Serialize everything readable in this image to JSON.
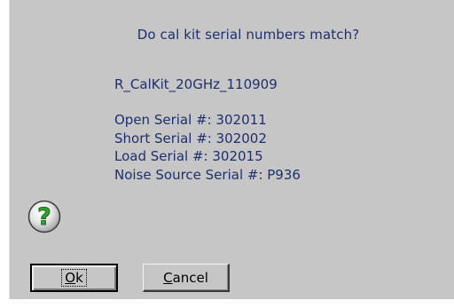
{
  "dialog": {
    "question": "Do cal kit serial numbers match?",
    "calkit_name": "R_CalKit_20GHz_110909",
    "serials": {
      "open": "Open Serial #: 302011",
      "short": "Short Serial #: 302002",
      "load": "Load Serial #: 302015",
      "noise": "Noise Source Serial #: P936"
    },
    "icon": "question-icon",
    "buttons": {
      "ok_mnemonic": "O",
      "ok_rest": "k",
      "cancel_mnemonic": "C",
      "cancel_rest": "ancel"
    }
  },
  "colors": {
    "background": "#c6c6c6",
    "text": "#1f2f6e",
    "icon_green": "#2fa12f"
  }
}
